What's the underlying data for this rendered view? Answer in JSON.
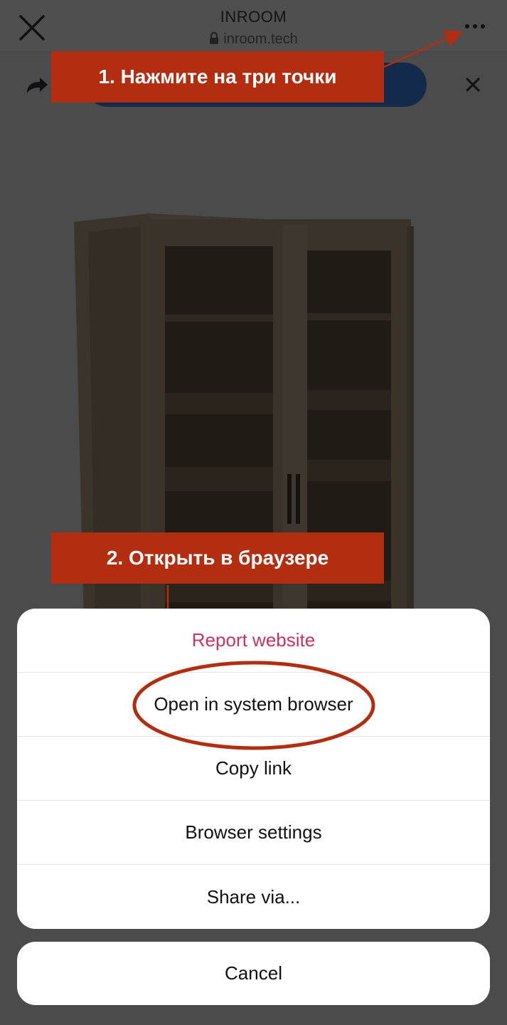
{
  "browser": {
    "title": "INROOM",
    "url": "inroom.tech"
  },
  "annotations": {
    "step1": "1. Нажмите на три точки",
    "step2": "2. Открыть в браузере"
  },
  "action_sheet": {
    "items": [
      {
        "label": "Report website"
      },
      {
        "label": "Open in system browser"
      },
      {
        "label": "Copy link"
      },
      {
        "label": "Browser settings"
      },
      {
        "label": "Share via..."
      }
    ],
    "cancel_label": "Cancel"
  },
  "colors": {
    "annotation_red": "#b32d11",
    "destructive_pink": "#d0305a",
    "overlay_gray": "#4b4b4b"
  }
}
